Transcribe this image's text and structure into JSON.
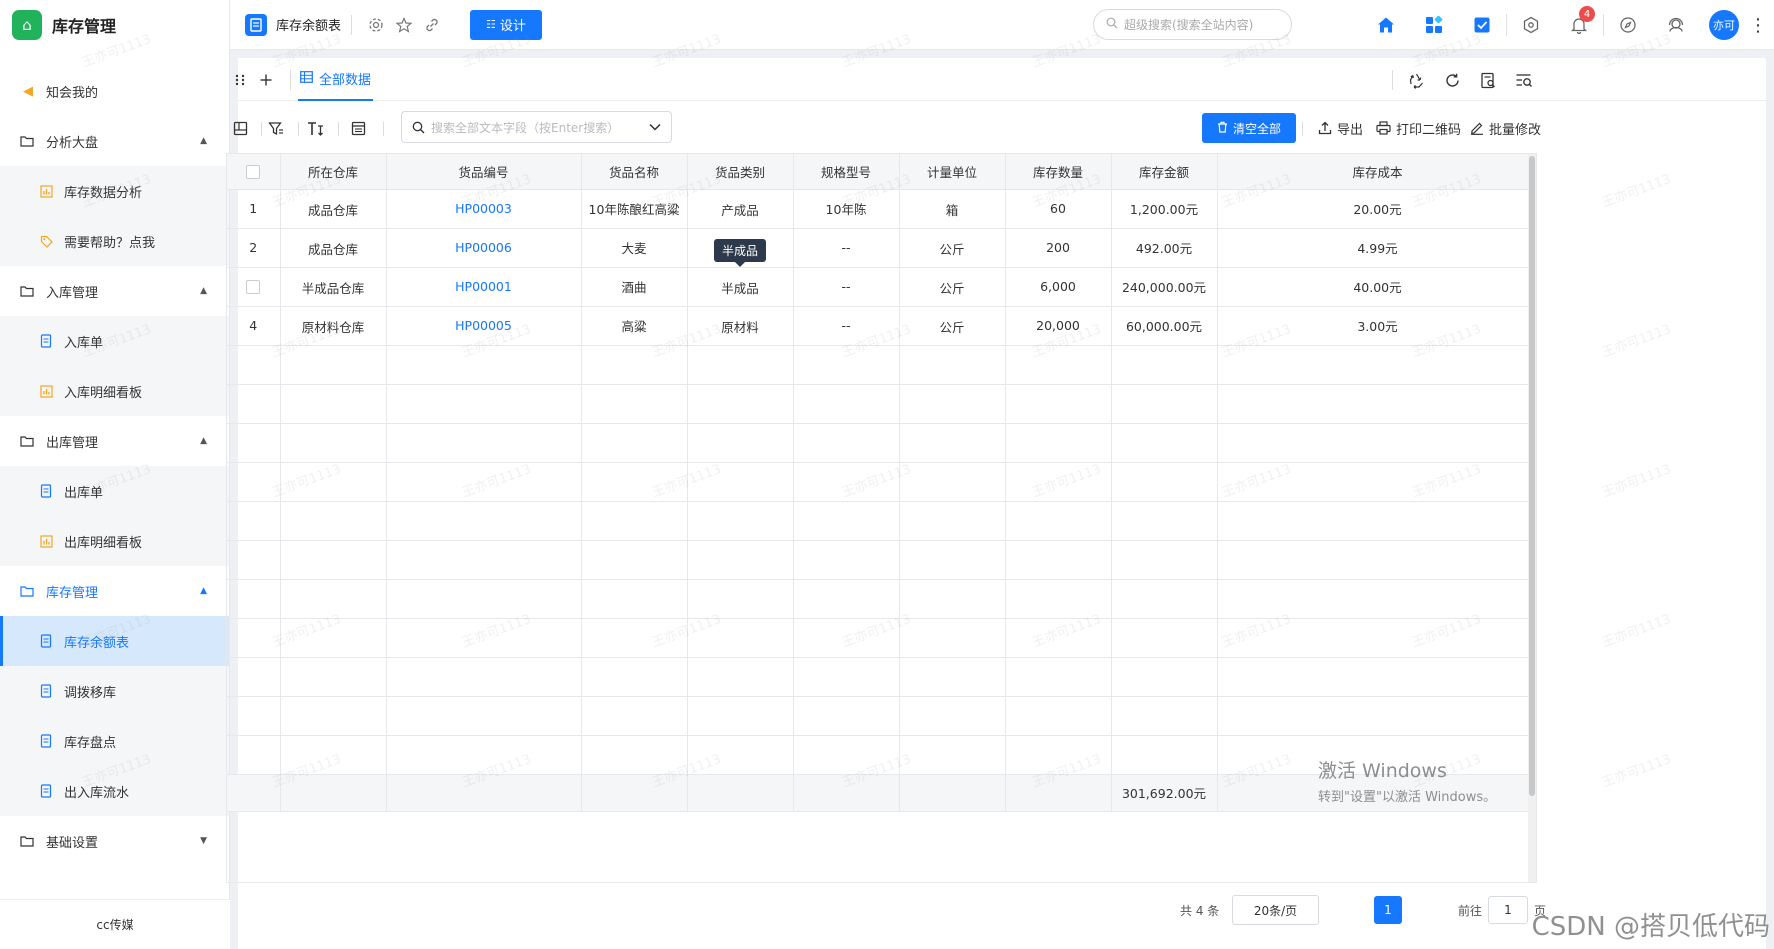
{
  "app": {
    "title": "库存管理"
  },
  "sidebar": {
    "notify": {
      "label": "知会我的",
      "icon": "megaphone-icon"
    },
    "groups": [
      {
        "label": "分析大盘",
        "icon": "folder-icon",
        "expanded": true,
        "items": [
          {
            "label": "库存数据分析",
            "icon": "chart-icon"
          },
          {
            "label": "需要帮助？点我",
            "icon": "tag-icon"
          }
        ]
      },
      {
        "label": "入库管理",
        "icon": "folder-icon",
        "expanded": true,
        "items": [
          {
            "label": "入库单",
            "icon": "document-icon"
          },
          {
            "label": "入库明细看板",
            "icon": "chart-icon"
          }
        ]
      },
      {
        "label": "出库管理",
        "icon": "folder-icon",
        "expanded": true,
        "items": [
          {
            "label": "出库单",
            "icon": "document-icon"
          },
          {
            "label": "出库明细看板",
            "icon": "chart-icon"
          }
        ]
      },
      {
        "label": "库存管理",
        "icon": "folder-icon",
        "expanded": true,
        "active": true,
        "items": [
          {
            "label": "库存余额表",
            "icon": "document-icon",
            "active": true
          },
          {
            "label": "调拨移库",
            "icon": "document-icon"
          },
          {
            "label": "库存盘点",
            "icon": "document-icon"
          },
          {
            "label": "出入库流水",
            "icon": "document-icon"
          }
        ]
      },
      {
        "label": "基础设置",
        "icon": "folder-icon",
        "expanded": false,
        "items": []
      }
    ],
    "footer": "cc传媒"
  },
  "topbar": {
    "page_title": "库存余额表",
    "design_label": "设计",
    "search_placeholder": "超级搜索(搜索全站内容)",
    "notification_count": "4",
    "avatar_text": "亦可"
  },
  "view": {
    "tab_label": "全部数据"
  },
  "toolbar": {
    "search_placeholder": "搜索全部文本字段（按Enter搜索）",
    "clear_label": "清空全部",
    "export_label": "导出",
    "print_label": "打印二维码",
    "batch_label": "批量修改"
  },
  "table": {
    "columns": [
      "所在仓库",
      "货品编号",
      "货品名称",
      "货品类别",
      "规格型号",
      "计量单位",
      "库存数量",
      "库存金额",
      "库存成本"
    ],
    "rows": [
      {
        "index": "1",
        "warehouse": "成品仓库",
        "code": "HP00003",
        "name": "10年陈酿红高粱",
        "category": "产成品",
        "spec": "10年陈",
        "unit": "箱",
        "qty": "60",
        "amount": "1,200.00元",
        "cost": "20.00元"
      },
      {
        "index": "2",
        "warehouse": "成品仓库",
        "code": "HP00006",
        "name": "大麦",
        "category": "",
        "spec": "--",
        "unit": "公斤",
        "qty": "200",
        "amount": "492.00元",
        "cost": "4.99元"
      },
      {
        "index": "",
        "warehouse": "半成品仓库",
        "code": "HP00001",
        "name": "酒曲",
        "category": "半成品",
        "spec": "--",
        "unit": "公斤",
        "qty": "6,000",
        "amount": "240,000.00元",
        "cost": "40.00元"
      },
      {
        "index": "4",
        "warehouse": "原材料仓库",
        "code": "HP00005",
        "name": "高粱",
        "category": "原材料",
        "spec": "--",
        "unit": "公斤",
        "qty": "20,000",
        "amount": "60,000.00元",
        "cost": "3.00元"
      }
    ],
    "tooltip": "半成品",
    "total_amount": "301,692.00元"
  },
  "pager": {
    "total": "共 4 条",
    "page_size": "20条/页",
    "current": "1",
    "goto": "前往",
    "goto_value": "1",
    "page_unit": "页"
  },
  "overlay": {
    "watermark": "王亦可1113",
    "activate_line1": "激活 Windows",
    "activate_line2": "转到\"设置\"以激活 Windows。",
    "csdn": "CSDN @搭贝低代码"
  },
  "colors": {
    "brand": "#21b35b",
    "accent": "#1677ff",
    "badge": "#f04b4b",
    "active_bg": "#d6e8fc"
  }
}
